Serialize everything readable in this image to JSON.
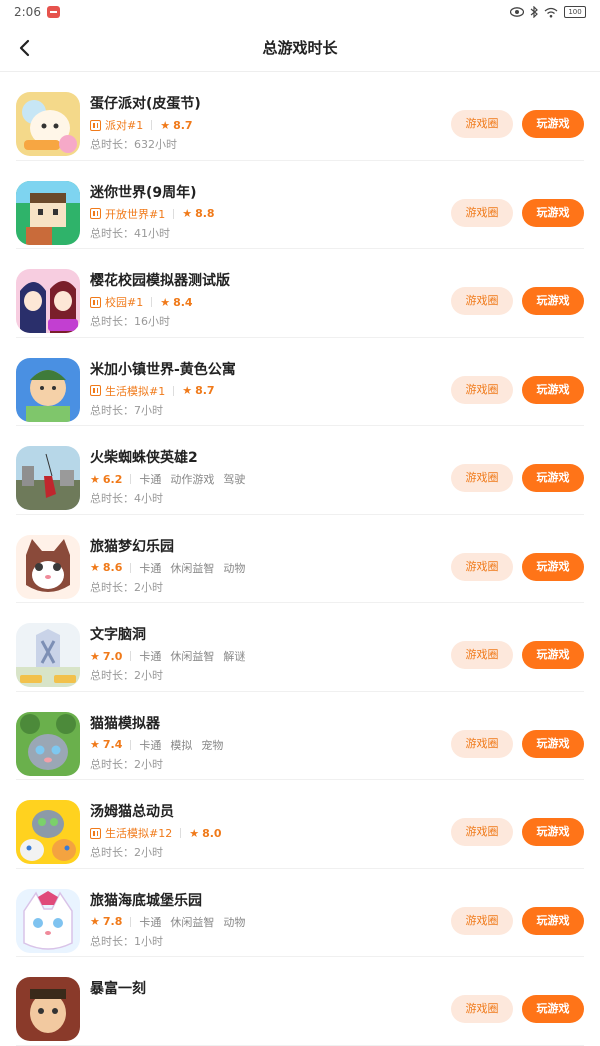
{
  "status_bar": {
    "time": "2:06",
    "battery": "100"
  },
  "header": {
    "title": "总游戏时长"
  },
  "buttons": {
    "circle": "游戏圈",
    "play": "玩游戏"
  },
  "colors": {
    "accent": "#ff7418",
    "accent_light": "#fde8dc",
    "rank_text": "#f07a1a"
  },
  "games": [
    {
      "name": "蛋仔派对(皮蛋节)",
      "rank": "派对#1",
      "rating": "8.7",
      "tags": [],
      "playtime": "总时长：632小时"
    },
    {
      "name": "迷你世界(9周年)",
      "rank": "开放世界#1",
      "rating": "8.8",
      "tags": [],
      "playtime": "总时长：41小时"
    },
    {
      "name": "樱花校园模拟器测试版",
      "rank": "校园#1",
      "rating": "8.4",
      "tags": [],
      "playtime": "总时长：16小时"
    },
    {
      "name": "米加小镇世界-黄色公寓",
      "rank": "生活模拟#1",
      "rating": "8.7",
      "tags": [],
      "playtime": "总时长：7小时"
    },
    {
      "name": "火柴蜘蛛侠英雄2",
      "rank": "",
      "rating": "6.2",
      "tags": [
        "卡通",
        "动作游戏",
        "驾驶"
      ],
      "playtime": "总时长：4小时"
    },
    {
      "name": "旅猫梦幻乐园",
      "rank": "",
      "rating": "8.6",
      "tags": [
        "卡通",
        "休闲益智",
        "动物"
      ],
      "playtime": "总时长：2小时"
    },
    {
      "name": "文字脑洞",
      "rank": "",
      "rating": "7.0",
      "tags": [
        "卡通",
        "休闲益智",
        "解谜"
      ],
      "playtime": "总时长：2小时"
    },
    {
      "name": "猫猫模拟器",
      "rank": "",
      "rating": "7.4",
      "tags": [
        "卡通",
        "模拟",
        "宠物"
      ],
      "playtime": "总时长：2小时"
    },
    {
      "name": "汤姆猫总动员",
      "rank": "生活模拟#12",
      "rating": "8.0",
      "tags": [],
      "playtime": "总时长：2小时"
    },
    {
      "name": "旅猫海底城堡乐园",
      "rank": "",
      "rating": "7.8",
      "tags": [
        "卡通",
        "休闲益智",
        "动物"
      ],
      "playtime": "总时长：1小时"
    },
    {
      "name": "暴富一刻",
      "rank": "",
      "rating": "",
      "tags": [],
      "playtime": ""
    }
  ]
}
